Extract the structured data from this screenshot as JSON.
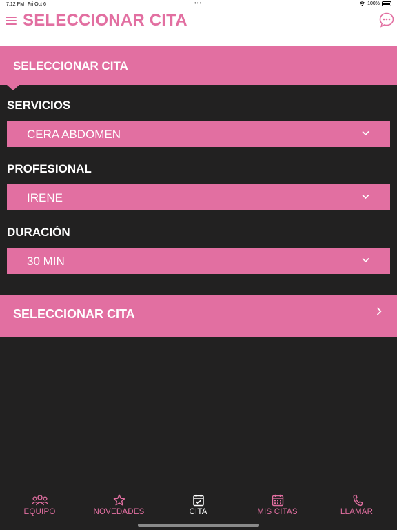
{
  "status_bar": {
    "time": "7:12 PM",
    "date": "Fri Oct 6",
    "dots": "•••",
    "battery": "100%"
  },
  "header": {
    "title": "SELECCIONAR CITA",
    "menu_icon": "hamburger-icon",
    "chat_icon": "chat-bubble-icon"
  },
  "panel": {
    "title": "SELECCIONAR CITA"
  },
  "fields": [
    {
      "label": "SERVICIOS",
      "value": "CERA ABDOMEN"
    },
    {
      "label": "PROFESIONAL",
      "value": "IRENE"
    },
    {
      "label": "DURACIÓN",
      "value": "30 MIN"
    }
  ],
  "action": {
    "label": "SELECCIONAR CITA"
  },
  "tabs": [
    {
      "label": "EQUIPO",
      "icon": "people-icon",
      "active": false
    },
    {
      "label": "NOVEDADES",
      "icon": "star-icon",
      "active": false
    },
    {
      "label": "CITA",
      "icon": "calendar-check-icon",
      "active": true
    },
    {
      "label": "MIS CITAS",
      "icon": "calendar-grid-icon",
      "active": false
    },
    {
      "label": "LLAMAR",
      "icon": "phone-icon",
      "active": false
    }
  ],
  "colors": {
    "accent": "#e26fa1",
    "background": "#222121",
    "header_bg": "#ffffff"
  }
}
